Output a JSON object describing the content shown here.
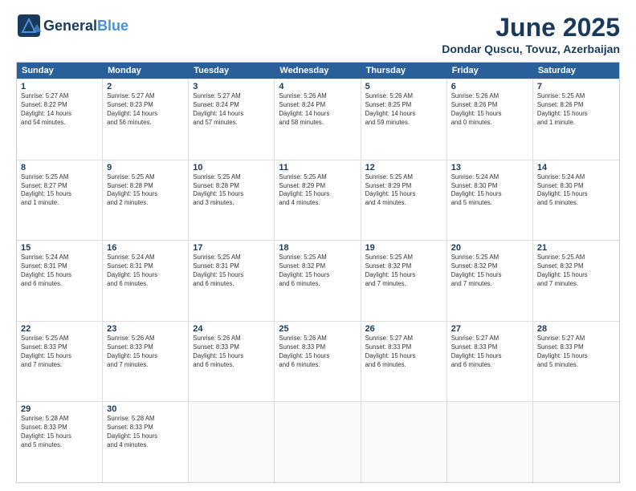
{
  "header": {
    "logo_general": "General",
    "logo_blue": "Blue",
    "month_title": "June 2025",
    "location": "Dondar Quscu, Tovuz, Azerbaijan"
  },
  "weekdays": [
    "Sunday",
    "Monday",
    "Tuesday",
    "Wednesday",
    "Thursday",
    "Friday",
    "Saturday"
  ],
  "rows": [
    [
      {
        "day": "1",
        "info": "Sunrise: 5:27 AM\nSunset: 8:22 PM\nDaylight: 14 hours\nand 54 minutes."
      },
      {
        "day": "2",
        "info": "Sunrise: 5:27 AM\nSunset: 8:23 PM\nDaylight: 14 hours\nand 56 minutes."
      },
      {
        "day": "3",
        "info": "Sunrise: 5:27 AM\nSunset: 8:24 PM\nDaylight: 14 hours\nand 57 minutes."
      },
      {
        "day": "4",
        "info": "Sunrise: 5:26 AM\nSunset: 8:24 PM\nDaylight: 14 hours\nand 58 minutes."
      },
      {
        "day": "5",
        "info": "Sunrise: 5:26 AM\nSunset: 8:25 PM\nDaylight: 14 hours\nand 59 minutes."
      },
      {
        "day": "6",
        "info": "Sunrise: 5:26 AM\nSunset: 8:26 PM\nDaylight: 15 hours\nand 0 minutes."
      },
      {
        "day": "7",
        "info": "Sunrise: 5:25 AM\nSunset: 8:26 PM\nDaylight: 15 hours\nand 1 minute."
      }
    ],
    [
      {
        "day": "8",
        "info": "Sunrise: 5:25 AM\nSunset: 8:27 PM\nDaylight: 15 hours\nand 1 minute."
      },
      {
        "day": "9",
        "info": "Sunrise: 5:25 AM\nSunset: 8:28 PM\nDaylight: 15 hours\nand 2 minutes."
      },
      {
        "day": "10",
        "info": "Sunrise: 5:25 AM\nSunset: 8:28 PM\nDaylight: 15 hours\nand 3 minutes."
      },
      {
        "day": "11",
        "info": "Sunrise: 5:25 AM\nSunset: 8:29 PM\nDaylight: 15 hours\nand 4 minutes."
      },
      {
        "day": "12",
        "info": "Sunrise: 5:25 AM\nSunset: 8:29 PM\nDaylight: 15 hours\nand 4 minutes."
      },
      {
        "day": "13",
        "info": "Sunrise: 5:24 AM\nSunset: 8:30 PM\nDaylight: 15 hours\nand 5 minutes."
      },
      {
        "day": "14",
        "info": "Sunrise: 5:24 AM\nSunset: 8:30 PM\nDaylight: 15 hours\nand 5 minutes."
      }
    ],
    [
      {
        "day": "15",
        "info": "Sunrise: 5:24 AM\nSunset: 8:31 PM\nDaylight: 15 hours\nand 6 minutes."
      },
      {
        "day": "16",
        "info": "Sunrise: 5:24 AM\nSunset: 8:31 PM\nDaylight: 15 hours\nand 6 minutes."
      },
      {
        "day": "17",
        "info": "Sunrise: 5:25 AM\nSunset: 8:31 PM\nDaylight: 15 hours\nand 6 minutes."
      },
      {
        "day": "18",
        "info": "Sunrise: 5:25 AM\nSunset: 8:32 PM\nDaylight: 15 hours\nand 6 minutes."
      },
      {
        "day": "19",
        "info": "Sunrise: 5:25 AM\nSunset: 8:32 PM\nDaylight: 15 hours\nand 7 minutes."
      },
      {
        "day": "20",
        "info": "Sunrise: 5:25 AM\nSunset: 8:32 PM\nDaylight: 15 hours\nand 7 minutes."
      },
      {
        "day": "21",
        "info": "Sunrise: 5:25 AM\nSunset: 8:32 PM\nDaylight: 15 hours\nand 7 minutes."
      }
    ],
    [
      {
        "day": "22",
        "info": "Sunrise: 5:25 AM\nSunset: 8:33 PM\nDaylight: 15 hours\nand 7 minutes."
      },
      {
        "day": "23",
        "info": "Sunrise: 5:26 AM\nSunset: 8:33 PM\nDaylight: 15 hours\nand 7 minutes."
      },
      {
        "day": "24",
        "info": "Sunrise: 5:26 AM\nSunset: 8:33 PM\nDaylight: 15 hours\nand 6 minutes."
      },
      {
        "day": "25",
        "info": "Sunrise: 5:26 AM\nSunset: 8:33 PM\nDaylight: 15 hours\nand 6 minutes."
      },
      {
        "day": "26",
        "info": "Sunrise: 5:27 AM\nSunset: 8:33 PM\nDaylight: 15 hours\nand 6 minutes."
      },
      {
        "day": "27",
        "info": "Sunrise: 5:27 AM\nSunset: 8:33 PM\nDaylight: 15 hours\nand 6 minutes."
      },
      {
        "day": "28",
        "info": "Sunrise: 5:27 AM\nSunset: 8:33 PM\nDaylight: 15 hours\nand 5 minutes."
      }
    ],
    [
      {
        "day": "29",
        "info": "Sunrise: 5:28 AM\nSunset: 8:33 PM\nDaylight: 15 hours\nand 5 minutes."
      },
      {
        "day": "30",
        "info": "Sunrise: 5:28 AM\nSunset: 8:33 PM\nDaylight: 15 hours\nand 4 minutes."
      },
      {
        "day": "",
        "info": ""
      },
      {
        "day": "",
        "info": ""
      },
      {
        "day": "",
        "info": ""
      },
      {
        "day": "",
        "info": ""
      },
      {
        "day": "",
        "info": ""
      }
    ]
  ]
}
